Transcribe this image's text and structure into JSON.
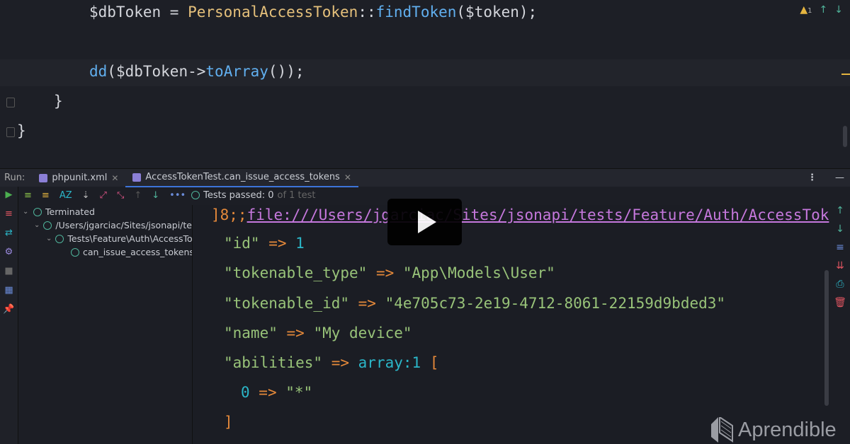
{
  "editor": {
    "lines": [
      {
        "var": "$dbToken",
        "op": " = ",
        "cls": "PersonalAccessToken",
        "sep": "::",
        "fn": "findToken",
        "args": "($token);"
      },
      {
        "fn": "dd",
        "p1": "(",
        "var": "$dbToken",
        "arrow": "->",
        "method": "toArray",
        "tail": "());"
      },
      {
        "text": "}"
      },
      {
        "text": "}"
      }
    ],
    "warnings_count": "1"
  },
  "run": {
    "label": "Run:",
    "tabs": [
      {
        "label": "phpunit.xml"
      },
      {
        "label": "AccessTokenTest.can_issue_access_tokens",
        "active": true
      }
    ],
    "status": "Tests passed: 0",
    "status_suffix": " of 1 test",
    "tree": [
      "Terminated",
      "/Users/jgarciac/Sites/jsonapi/tests",
      "Tests\\Feature\\Auth\\AccessTokenTest",
      "can_issue_access_tokens"
    ]
  },
  "console": {
    "prefix": "]8;;",
    "link": "file:///Users/jgarciac/Sites/jsonapi/tests/Feature/Auth/AccessTok",
    "rows": [
      {
        "key": "\"id\"",
        "arrow": " => ",
        "val": "1",
        "type": "num"
      },
      {
        "key": "\"tokenable_type\"",
        "arrow": " => ",
        "val": "\"App\\Models\\User\"",
        "type": "str"
      },
      {
        "key": "\"tokenable_id\"",
        "arrow": " => ",
        "val": "\"4e705c73-2e19-4712-8061-22159d9bded3\"",
        "type": "str"
      },
      {
        "key": "\"name\"",
        "arrow": " => ",
        "val": "\"My device\"",
        "type": "str"
      },
      {
        "key": "\"abilities\"",
        "arrow": " => ",
        "val": "array:1",
        "bracket": " [",
        "type": "arr"
      }
    ],
    "nested": {
      "key": "0",
      "arrow": " => ",
      "val": "\"*\""
    },
    "close": "]"
  },
  "brand": "Aprendible"
}
